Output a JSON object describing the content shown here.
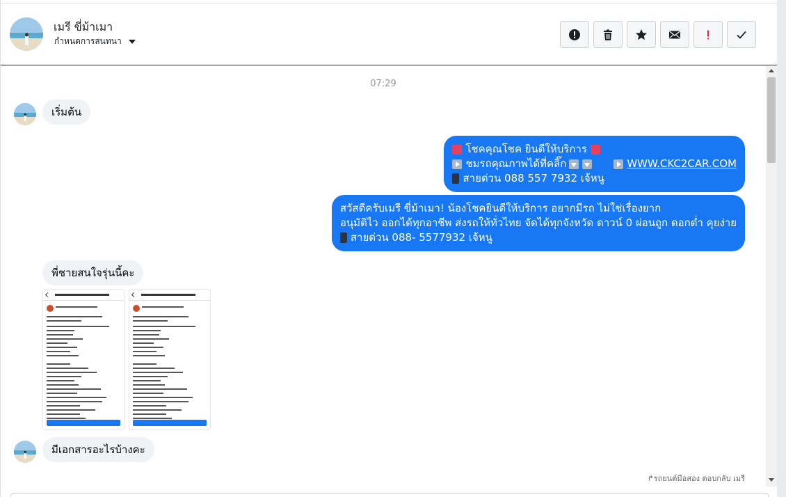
{
  "header": {
    "contact_name": "เมรี ขี่ม้าเมา",
    "conversation_settings": "กำหนดการสนทนา",
    "toolbar": {
      "mark_spam": "exclamation-circle-icon",
      "delete": "trash-icon",
      "star": "star-icon",
      "mark_unread": "envelope-icon",
      "follow_up": "red-exclamation-icon",
      "mark_done": "checkmark-icon"
    }
  },
  "conversation": {
    "timestamp": "07:29",
    "messages": [
      {
        "direction": "in",
        "text": "เริ่มต้น"
      },
      {
        "direction": "out",
        "lines": [
          "โชคคุณโชค ยินดีให้บริการ",
          "ชมรถคุณภาพได้ที่คลิ๊ก",
          "WWW.CKC2CAR.COM",
          "สายด่วน 088 557 7932 เจ้หนู"
        ]
      },
      {
        "direction": "out",
        "lines": [
          "สวัสดีครับเมรี ขี่ม้าเมา! น้องโชคยินดีให้บริการ อยากมีรถ ไม่ใช่เรื่องยาก",
          "อนุมัติไว ออกได้ทุกอาชีพ ส่งรถให้ทั่วไทย จัดได้ทุกจังหวัด ดาวน์ 0  ผ่อนถูก ดอกต่ำ คุยง่าย",
          "สายด่วน 088- 5577932 เจ้หนู"
        ]
      },
      {
        "direction": "in",
        "text": "พี่ชายสนใจรุ่นนี้คะ"
      },
      {
        "direction": "in",
        "text": "มีเอกสารอะไรบ้างคะ"
      }
    ],
    "reply_note": "รถยนต์มือสอง ตอบกลับ เมรี"
  },
  "colors": {
    "outgoing_bubble": "#1877f2",
    "incoming_bubble": "#f0f2f5",
    "alert_red": "#e41e3f"
  }
}
